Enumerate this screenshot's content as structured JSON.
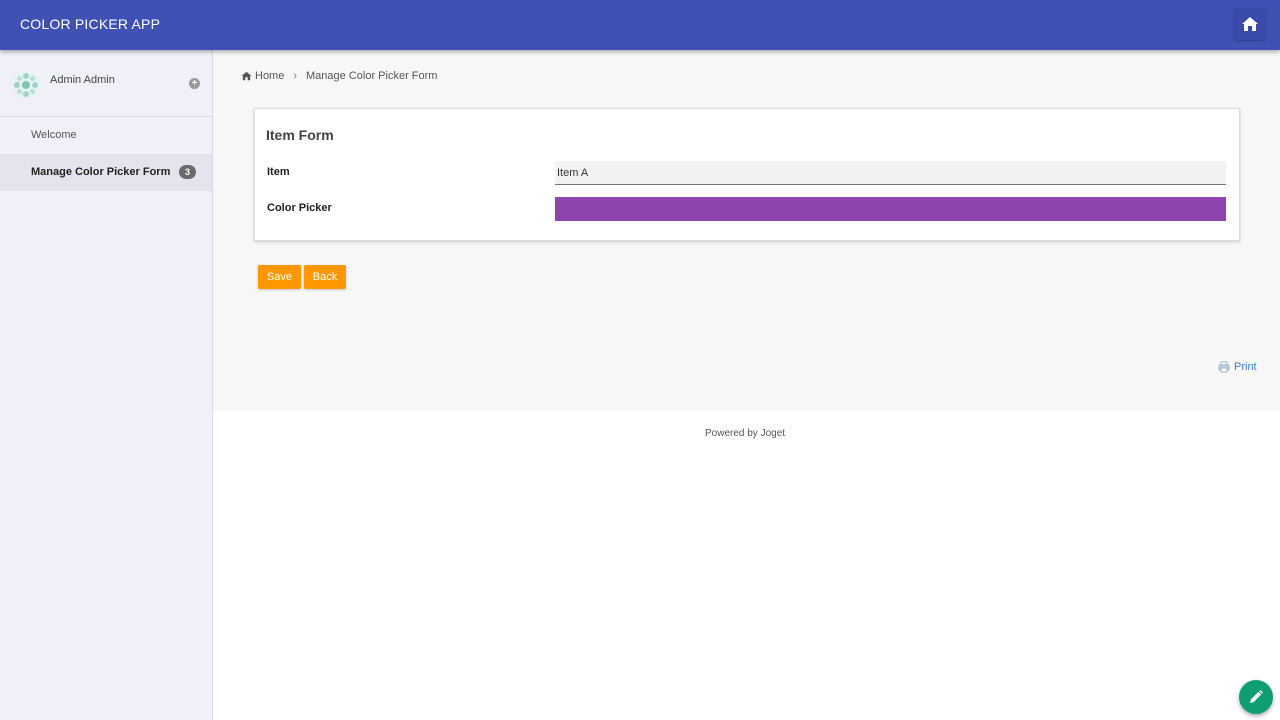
{
  "header": {
    "app_title": "COLOR PICKER APP",
    "home_icon": "home-icon"
  },
  "sidebar": {
    "user_name": "Admin Admin",
    "items": [
      {
        "label": "Welcome",
        "active": false
      },
      {
        "label": "Manage Color Picker Form",
        "active": true,
        "badge": "3"
      }
    ]
  },
  "breadcrumb": {
    "home": "Home",
    "current": "Manage Color Picker Form"
  },
  "form": {
    "title": "Item Form",
    "fields": {
      "item_label": "Item",
      "item_value": "Item A",
      "color_label": "Color Picker",
      "color_value": "#8e44ad"
    }
  },
  "buttons": {
    "save": "Save",
    "back": "Back"
  },
  "print_label": "Print",
  "footer": "Powered by Joget",
  "colors": {
    "header": "#3f51b5",
    "button": "#ff9800",
    "fab": "#0f9d74"
  }
}
